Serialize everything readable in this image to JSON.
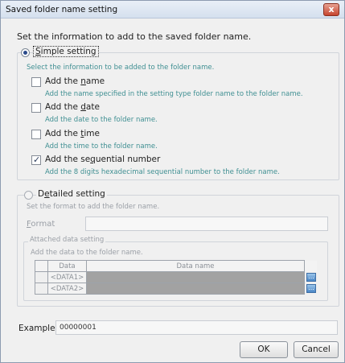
{
  "window": {
    "title": "Saved folder name setting",
    "close_label": "x"
  },
  "intro": "Set the information to add to the saved folder name.",
  "simple": {
    "label": "Simple setting",
    "mnemonic": "S",
    "label_rest": "imple setting",
    "description": "Select the information to be added to the folder name.",
    "options": [
      {
        "pre": "Add the ",
        "mnem": "n",
        "post": "ame",
        "checked": false,
        "desc": "Add the name specified in the setting type folder name to the folder name."
      },
      {
        "pre": "Add the ",
        "mnem": "d",
        "post": "ate",
        "checked": false,
        "desc": "Add the date to the folder name."
      },
      {
        "pre": "Add the ",
        "mnem": "t",
        "post": "ime",
        "checked": false,
        "desc": "Add the time to the folder name."
      },
      {
        "pre": "Add the se",
        "mnem": "q",
        "post": "uential number",
        "checked": true,
        "desc": "Add the 8 digits hexadecimal sequential number to the folder name."
      }
    ]
  },
  "detailed": {
    "pre": "D",
    "mnem": "e",
    "post": "tailed setting",
    "description": "Set the format to add the folder name.",
    "format_mnem": "F",
    "format_rest": "ormat",
    "format_value": "",
    "attached": {
      "title": "Attached data setting",
      "description": "Add the data to the folder name.",
      "columns": [
        "Data",
        "Data name"
      ],
      "rows": [
        {
          "data": "<DATA1>",
          "name": "",
          "btn": "..."
        },
        {
          "data": "<DATA2>",
          "name": "",
          "btn": "..."
        }
      ]
    }
  },
  "example": {
    "label": "Example",
    "value": "00000001"
  },
  "buttons": {
    "ok": "OK",
    "cancel": "Cancel"
  }
}
